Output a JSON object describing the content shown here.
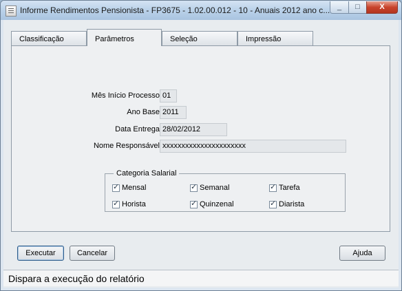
{
  "window": {
    "title": "Informe Rendimentos Pensionista - FP3675 - 1.02.00.012 - 10 - Anuais 2012 ano c...",
    "minimize_label": "_",
    "maximize_label": "□",
    "close_label": "X"
  },
  "tabs": [
    "Classificação",
    "Parâmetros",
    "Seleção",
    "Impressão"
  ],
  "active_tab": "Parâmetros",
  "params": {
    "mes_inicio_label": "Mês Início Processo:",
    "mes_inicio_value": "01",
    "ano_base_label": "Ano Base:",
    "ano_base_value": "2011",
    "data_entrega_label": "Data Entrega:",
    "data_entrega_value": "28/02/2012",
    "nome_resp_label": "Nome Responsável:",
    "nome_resp_value": "xxxxxxxxxxxxxxxxxxxxxx"
  },
  "categoria": {
    "legend": "Categoria Salarial",
    "items": [
      {
        "label": "Mensal",
        "checked": true
      },
      {
        "label": "Semanal",
        "checked": true
      },
      {
        "label": "Tarefa",
        "checked": true
      },
      {
        "label": "Horista",
        "checked": true
      },
      {
        "label": "Quinzenal",
        "checked": true
      },
      {
        "label": "Diarista",
        "checked": true
      }
    ]
  },
  "buttons": {
    "executar": "Executar",
    "cancelar": "Cancelar",
    "ajuda": "Ajuda"
  },
  "status": "Dispara a execução do relatório"
}
